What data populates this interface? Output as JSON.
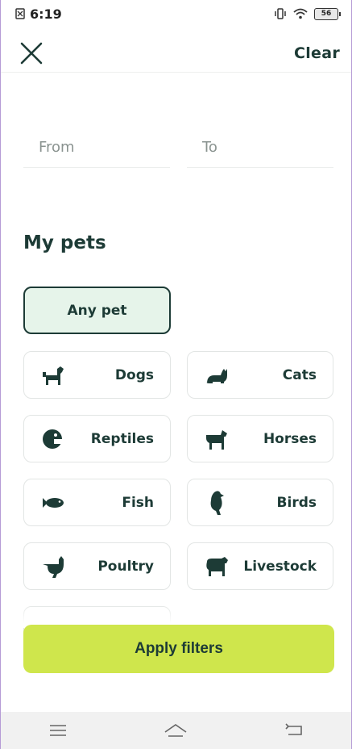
{
  "status": {
    "time": "6:19",
    "battery": "56"
  },
  "header": {
    "clear_label": "Clear"
  },
  "dates": {
    "from_placeholder": "From",
    "to_placeholder": "To"
  },
  "section_title": "My pets",
  "any_pet_label": "Any pet",
  "pets": [
    {
      "label": "Dogs",
      "icon": "dog-icon"
    },
    {
      "label": "Cats",
      "icon": "cat-icon"
    },
    {
      "label": "Reptiles",
      "icon": "reptile-icon"
    },
    {
      "label": "Horses",
      "icon": "horse-icon"
    },
    {
      "label": "Fish",
      "icon": "fish-icon"
    },
    {
      "label": "Birds",
      "icon": "bird-icon"
    },
    {
      "label": "Poultry",
      "icon": "poultry-icon"
    },
    {
      "label": "Livestock",
      "icon": "livestock-icon"
    }
  ],
  "apply_label": "Apply filters",
  "colors": {
    "primary": "#1d3b36",
    "accent": "#cfe64c",
    "selected_bg": "#e6f4ea"
  }
}
